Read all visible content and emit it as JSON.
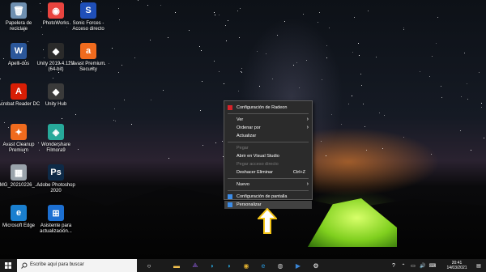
{
  "desktop": {
    "icons": [
      {
        "label": "Papelera de reciclaje",
        "glyph": "🗑",
        "bg": "#6e8fb0",
        "icon": "recycle-bin-icon"
      },
      {
        "label": "PhotoWorks",
        "glyph": "◉",
        "bg": "#e9443f",
        "icon": "photoworks-icon"
      },
      {
        "label": "Sonic Forces - Acceso directo",
        "glyph": "S",
        "bg": "#1f4fb8",
        "icon": "sonic-forces-icon"
      },
      {
        "label": "Apelli-dos",
        "glyph": "W",
        "bg": "#2b579a",
        "icon": "word-document-icon"
      },
      {
        "label": "Unity 2019.4.12f1 (64-bit)",
        "glyph": "◆",
        "bg": "#2a2a2a",
        "icon": "unity-icon"
      },
      {
        "label": "Avast Premium Security",
        "glyph": "a",
        "bg": "#f06b1e",
        "icon": "avast-icon"
      },
      {
        "label": "Acrobat Reader DC",
        "glyph": "A",
        "bg": "#d81e05",
        "icon": "acrobat-reader-icon"
      },
      {
        "label": "Unity Hub",
        "glyph": "◆",
        "bg": "#3a3a3a",
        "icon": "unity-hub-icon"
      },
      {
        "label": "Avast Cleanup Premium",
        "glyph": "✦",
        "bg": "#f06b1e",
        "icon": "avast-cleanup-icon"
      },
      {
        "label": "Wondershare Filmora9",
        "glyph": "◈",
        "bg": "#27a99a",
        "icon": "filmora-icon"
      },
      {
        "label": "IMG_20210226_...",
        "glyph": "▦",
        "bg": "#9aa3ab",
        "icon": "image-file-icon"
      },
      {
        "label": "Adobe Photoshop 2020",
        "glyph": "Ps",
        "bg": "#0e2a47",
        "icon": "photoshop-icon"
      },
      {
        "label": "Microsoft Edge",
        "glyph": "e",
        "bg": "#1a7fcf",
        "icon": "edge-icon"
      },
      {
        "label": "Asistente para actualización...",
        "glyph": "⊞",
        "bg": "#1c6fd1",
        "icon": "windows-update-assistant-icon"
      }
    ]
  },
  "context_menu": {
    "items": [
      {
        "type": "item",
        "label": "Configuración de Radeon",
        "icon": "radeon-icon",
        "disabled": false
      },
      {
        "type": "sep"
      },
      {
        "type": "item",
        "label": "Ver",
        "submenu": true,
        "disabled": false
      },
      {
        "type": "item",
        "label": "Ordenar por",
        "submenu": true,
        "disabled": false
      },
      {
        "type": "item",
        "label": "Actualizar",
        "disabled": false
      },
      {
        "type": "sep"
      },
      {
        "type": "item",
        "label": "Pegar",
        "disabled": true
      },
      {
        "type": "item",
        "label": "Abrir en Visual Studio",
        "disabled": false
      },
      {
        "type": "item",
        "label": "Pegar acceso directo",
        "disabled": true
      },
      {
        "type": "item",
        "label": "Deshacer Eliminar",
        "shortcut": "Ctrl+Z",
        "disabled": false
      },
      {
        "type": "sep"
      },
      {
        "type": "item",
        "label": "Nuevo",
        "submenu": true,
        "disabled": false
      },
      {
        "type": "sep"
      },
      {
        "type": "item",
        "label": "Configuración de pantalla",
        "icon": "display-settings-icon",
        "disabled": false
      },
      {
        "type": "item",
        "label": "Personalizar",
        "icon": "personalize-icon",
        "disabled": false,
        "highlighted": true
      }
    ]
  },
  "taskbar": {
    "search_placeholder": "Escribe aquí para buscar",
    "apps": [
      "task-view-icon",
      "file-explorer-icon",
      "visual-studio-icon",
      "dolphin-icon",
      "dolphin-icon-2",
      "chrome-icon",
      "edge-taskbar-icon",
      "camera-icon",
      "video-icon",
      "settings-icon"
    ],
    "clock_time": "20:41",
    "clock_date": "14/03/2021"
  },
  "colors": {
    "accent": "#f5c518",
    "taskbar": "#1b1b1b",
    "menu": "#2b2b2b"
  }
}
